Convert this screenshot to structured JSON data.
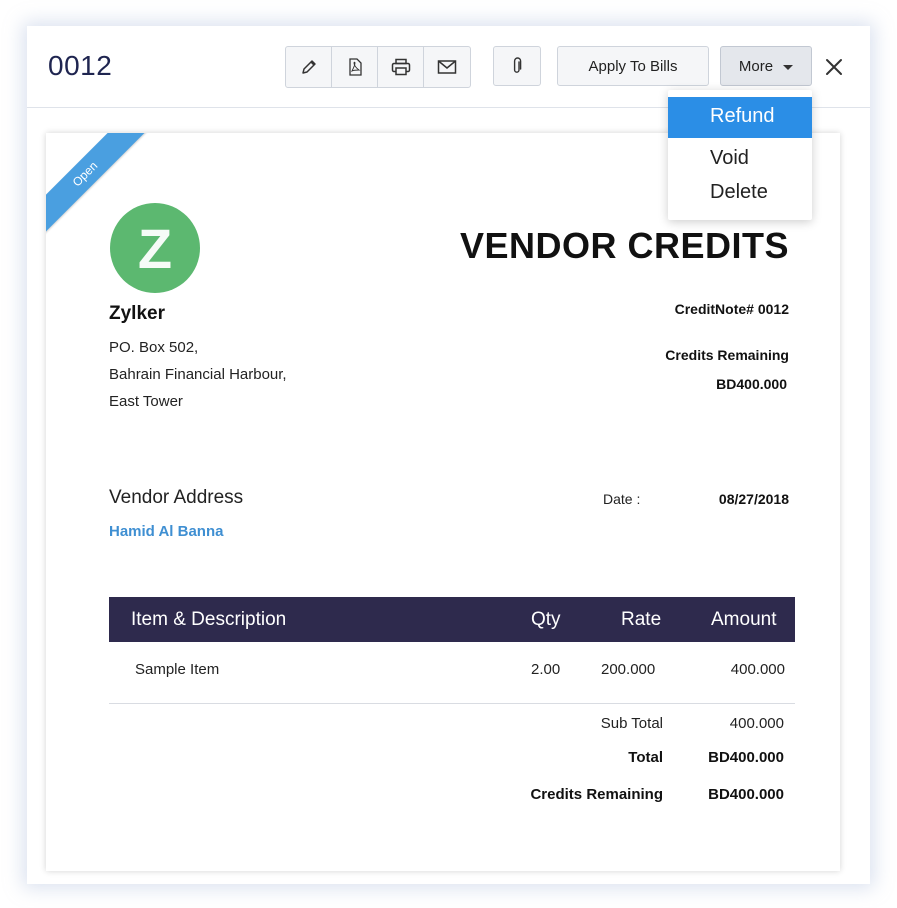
{
  "header": {
    "doc_id": "0012",
    "apply_label": "Apply To Bills",
    "more_label": "More"
  },
  "dropdown": {
    "items": [
      {
        "label": "Refund",
        "active": true
      },
      {
        "label": "Void",
        "active": false
      },
      {
        "label": "Delete",
        "active": false
      }
    ]
  },
  "document": {
    "status_ribbon": "Open",
    "logo_letter": "Z",
    "org_name": "Zylker",
    "address_lines": [
      "PO. Box 502,",
      "Bahrain Financial Harbour,",
      "East Tower"
    ],
    "title": "VENDOR CREDITS",
    "credit_note": "CreditNote# 0012",
    "credits_remaining_label": "Credits Remaining",
    "credits_remaining_value": "BD400.000",
    "vendor_address_label": "Vendor Address",
    "vendor_name": "Hamid Al Banna",
    "date_label": "Date :",
    "date_value": "08/27/2018"
  },
  "table": {
    "headers": {
      "item": "Item & Description",
      "qty": "Qty",
      "rate": "Rate",
      "amount": "Amount"
    },
    "rows": [
      {
        "item": "Sample Item",
        "qty": "2.00",
        "rate": "200.000",
        "amount": "400.000"
      }
    ]
  },
  "totals": {
    "subtotal_label": "Sub Total",
    "subtotal_value": "400.000",
    "total_label": "Total",
    "total_value": "BD400.000",
    "credits_label": "Credits Remaining",
    "credits_value": "BD400.000"
  },
  "colors": {
    "accent": "#2b8ee6",
    "table_header": "#2e2a4d",
    "logo": "#5cb870",
    "ribbon": "#4a9fe0",
    "vendor_link": "#3f8fd2"
  },
  "icons": [
    "edit-icon",
    "pdf-icon",
    "print-icon",
    "email-icon",
    "attachment-icon",
    "close-icon"
  ]
}
